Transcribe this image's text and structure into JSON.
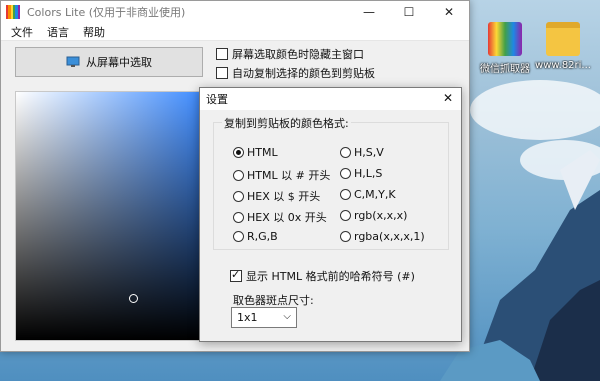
{
  "window": {
    "title": "Colors Lite (仅用于非商业使用)",
    "minimize_icon": "minimize-icon",
    "maximize_icon": "maximize-icon",
    "close_icon": "close-icon"
  },
  "menu": {
    "items": [
      "文件",
      "语言",
      "帮助"
    ]
  },
  "main": {
    "pick_button_label": "从屏幕中选取",
    "options": [
      {
        "label": "屏幕选取颜色时隐藏主窗口",
        "checked": false
      },
      {
        "label": "自动复制选择的颜色到剪贴板",
        "checked": false
      }
    ]
  },
  "settings": {
    "title": "设置",
    "group_label": "复制到剪贴板的颜色格式:",
    "formats_left": [
      {
        "label": "HTML",
        "checked": true
      },
      {
        "label": "HTML 以 # 开头",
        "checked": false
      },
      {
        "label": "HEX 以 $ 开头",
        "checked": false
      },
      {
        "label": "HEX 以 0x 开头",
        "checked": false
      },
      {
        "label": "R,G,B",
        "checked": false
      }
    ],
    "formats_right": [
      {
        "label": "H,S,V",
        "checked": false
      },
      {
        "label": "H,L,S",
        "checked": false
      },
      {
        "label": "C,M,Y,K",
        "checked": false
      },
      {
        "label": "rgb(x,x,x)",
        "checked": false
      },
      {
        "label": "rgba(x,x,x,1)",
        "checked": false
      }
    ],
    "hash_option": {
      "label": "显示 HTML 格式前的哈希符号 (#)",
      "checked": true
    },
    "size_label": "取色器斑点尺寸:",
    "size_value": "1x1"
  },
  "desktop": {
    "icons": [
      {
        "label": "微信抓取器"
      },
      {
        "label": "www.82ri..."
      }
    ]
  },
  "colors": {
    "accent_blue": "#3f8cff",
    "app_icon_stripes": [
      "#e53935",
      "#fb8c00",
      "#fdd835",
      "#43a047",
      "#1e88e5",
      "#8e24aa"
    ]
  }
}
